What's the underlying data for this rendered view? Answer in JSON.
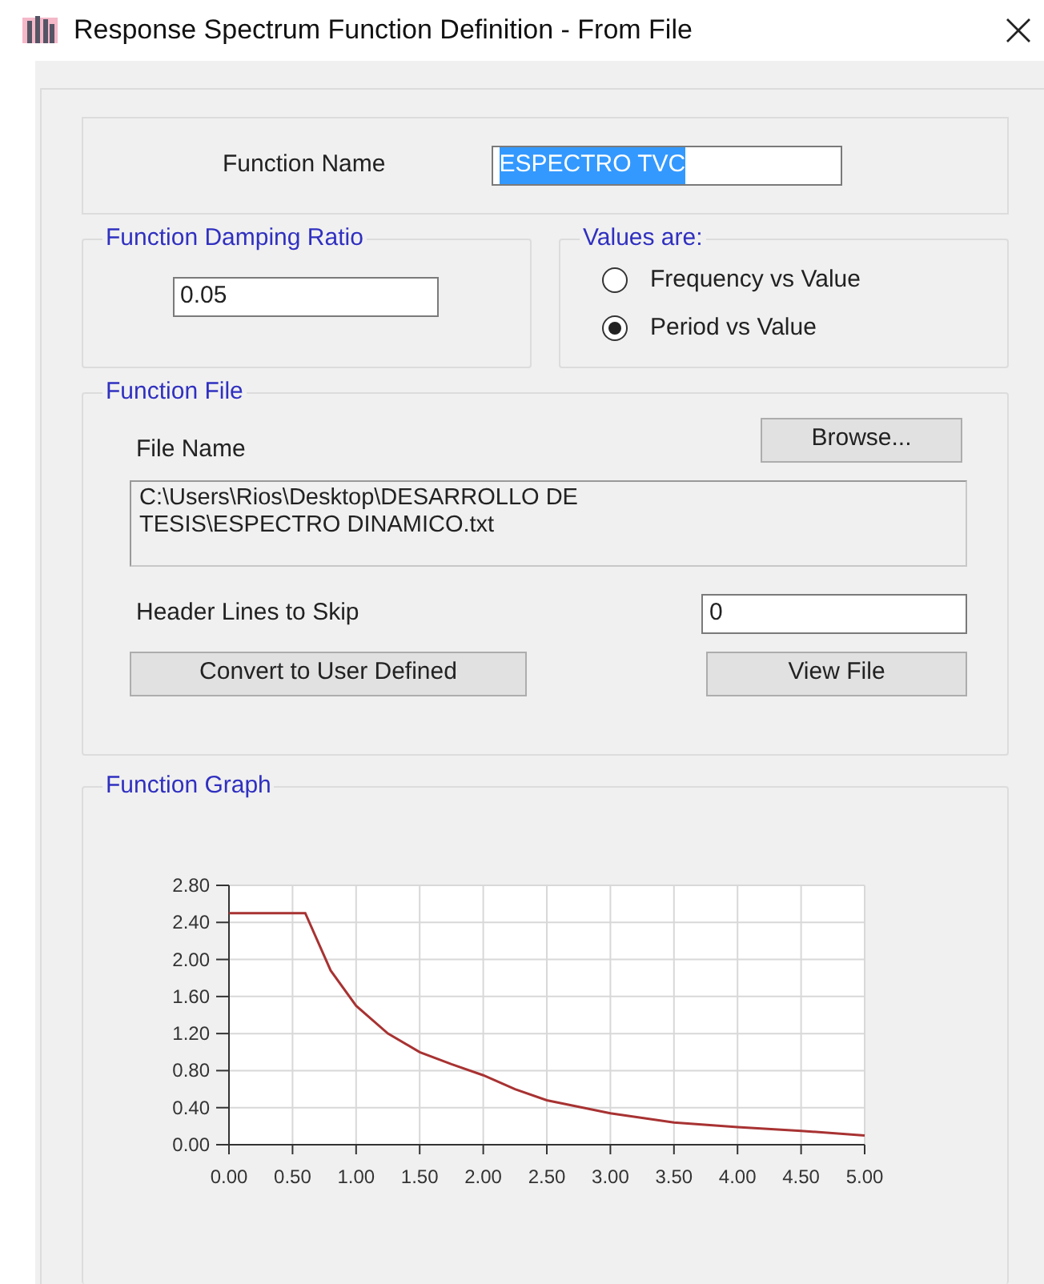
{
  "window": {
    "title": "Response Spectrum Function Definition - From File"
  },
  "function_name": {
    "label": "Function Name",
    "value": "ESPECTRO TVC",
    "text_selected": true
  },
  "damping": {
    "legend": "Function Damping Ratio",
    "value": "0.05"
  },
  "values_are": {
    "legend": "Values are:",
    "options": [
      {
        "label": "Frequency vs Value",
        "selected": false
      },
      {
        "label": "Period vs Value",
        "selected": true
      }
    ]
  },
  "function_file": {
    "legend": "Function File",
    "browse_button": "Browse...",
    "file_name_label": "File Name",
    "file_name": "C:\\Users\\Rios\\Desktop\\DESARROLLO DE TESIS\\ESPECTRO DINAMICO.txt",
    "header_lines_label": "Header Lines to Skip",
    "header_lines": "0",
    "convert_button": "Convert to User Defined",
    "view_button": "View File"
  },
  "function_graph": {
    "legend": "Function Graph",
    "chart_data": {
      "type": "line",
      "x": [
        0,
        0.6,
        0.8,
        1.0,
        1.25,
        1.5,
        1.75,
        2.0,
        2.25,
        2.5,
        3.0,
        3.5,
        4.0,
        4.5,
        5.0
      ],
      "grid": true,
      "series": [
        {
          "color": "#a83232",
          "values": [
            2.5,
            2.5,
            1.88,
            1.5,
            1.2,
            1.0,
            0.87,
            0.75,
            0.6,
            0.48,
            0.34,
            0.24,
            0.19,
            0.15,
            0.1
          ]
        }
      ],
      "xlim": [
        0,
        5
      ],
      "ylim": [
        0,
        2.8
      ],
      "xticks": [
        {
          "value": 0,
          "label": "0.00"
        },
        {
          "value": 0.5,
          "label": "0.50"
        },
        {
          "value": 1,
          "label": "1.00"
        },
        {
          "value": 1.5,
          "label": "1.50"
        },
        {
          "value": 2,
          "label": "2.00"
        },
        {
          "value": 2.5,
          "label": "2.50"
        },
        {
          "value": 3,
          "label": "3.00"
        },
        {
          "value": 3.5,
          "label": "3.50"
        },
        {
          "value": 4,
          "label": "4.00"
        },
        {
          "value": 4.5,
          "label": "4.50"
        },
        {
          "value": 5,
          "label": "5.00"
        }
      ],
      "yticks": [
        {
          "value": 0,
          "label": "0.00"
        },
        {
          "value": 0.4,
          "label": "0.40"
        },
        {
          "value": 0.8,
          "label": "0.80"
        },
        {
          "value": 1.2,
          "label": "1.20"
        },
        {
          "value": 1.6,
          "label": "1.60"
        },
        {
          "value": 2,
          "label": "2.00"
        },
        {
          "value": 2.4,
          "label": "2.40"
        },
        {
          "value": 2.8,
          "label": "2.80"
        }
      ]
    }
  }
}
